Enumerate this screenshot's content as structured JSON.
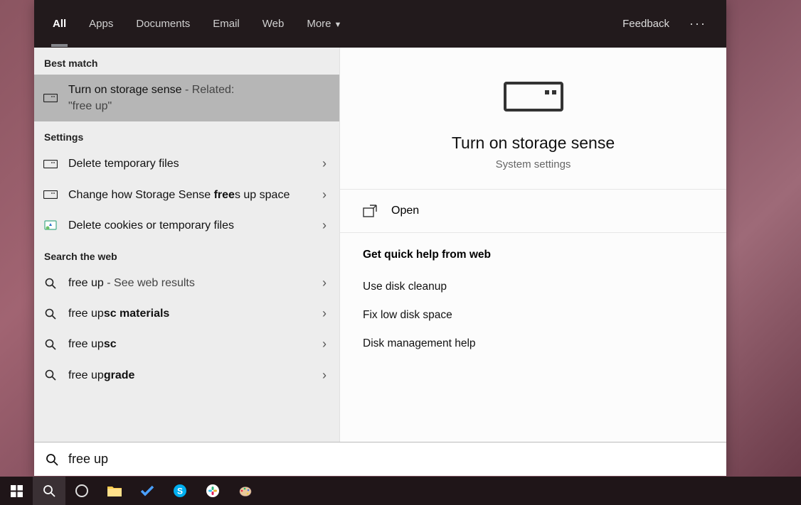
{
  "tabs": {
    "all": "All",
    "apps": "Apps",
    "documents": "Documents",
    "email": "Email",
    "web": "Web",
    "more": "More"
  },
  "feedback": "Feedback",
  "sections": {
    "best_match": "Best match",
    "settings": "Settings",
    "search_web": "Search the web"
  },
  "best_match": {
    "title": "Turn on storage sense",
    "suffix": " - Related: ",
    "quoted": "\"free up\""
  },
  "settings_items": [
    {
      "text": "Delete temporary files",
      "bold": ""
    },
    {
      "pre": "Change how Storage Sense ",
      "bold": "free",
      "post": "s up space"
    },
    {
      "text": "Delete cookies or temporary files",
      "bold": ""
    }
  ],
  "web_items": [
    {
      "pre": "free up",
      "bold": "",
      "suffix": " - See web results"
    },
    {
      "pre": "free up",
      "bold": "sc materials",
      "suffix": ""
    },
    {
      "pre": "free up",
      "bold": "sc",
      "suffix": ""
    },
    {
      "pre": "free up",
      "bold": "grade",
      "suffix": ""
    }
  ],
  "preview": {
    "title": "Turn on storage sense",
    "subtitle": "System settings",
    "open": "Open",
    "help_head": "Get quick help from web",
    "help_links": [
      "Use disk cleanup",
      "Fix low disk space",
      "Disk management help"
    ]
  },
  "search": {
    "value": "free up"
  }
}
